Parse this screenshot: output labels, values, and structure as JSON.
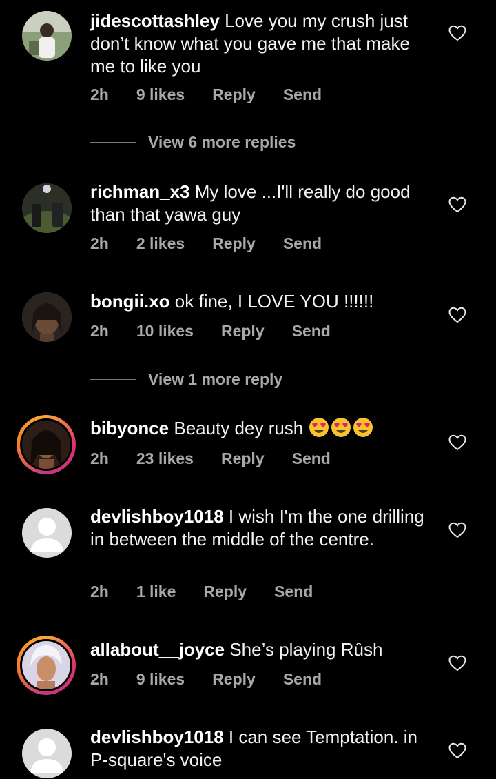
{
  "comments": [
    {
      "username": "jidescottashley",
      "text": "Love you my crush just don’t know what you gave me that make me to like you",
      "time": "2h",
      "likes": "9 likes",
      "reply": "Reply",
      "send": "Send"
    },
    {
      "username": "richman_x3",
      "text": "My love ...I'll really do good than that yawa guy",
      "time": "2h",
      "likes": "2 likes",
      "reply": "Reply",
      "send": "Send"
    },
    {
      "username": "bongii.xo",
      "text": "ok fine, I LOVE YOU !!!!!!",
      "time": "2h",
      "likes": "10 likes",
      "reply": "Reply",
      "send": "Send"
    },
    {
      "username": "bibyonce",
      "text": "Beauty dey rush",
      "time": "2h",
      "likes": "23 likes",
      "reply": "Reply",
      "send": "Send"
    },
    {
      "username": "devlishboy1018",
      "text": "I wish I'm the one drilling in between the middle of the centre.",
      "time": "2h",
      "likes": "1 like",
      "reply": "Reply",
      "send": "Send"
    },
    {
      "username": "allabout__joyce",
      "text": "She’s playing Rûsh",
      "time": "2h",
      "likes": "9 likes",
      "reply": "Reply",
      "send": "Send"
    },
    {
      "username": "devlishboy1018",
      "text": "I can see Temptation. in P-square's voice",
      "time": "",
      "likes": "",
      "reply": "",
      "send": ""
    }
  ],
  "view_more": [
    "View 6 more replies",
    "View 1 more reply"
  ],
  "icons": {
    "like": "heart-outline-icon",
    "emoji": "heart-eyes-emoji"
  },
  "colors": {
    "background": "#000000",
    "secondary_text": "#a8a8a8",
    "story_ring": "#e1306c"
  }
}
